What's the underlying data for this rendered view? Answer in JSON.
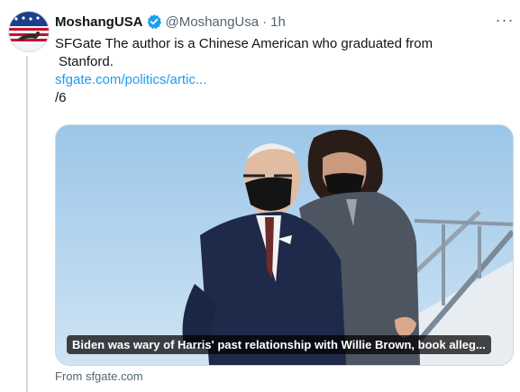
{
  "tweet": {
    "display_name": "MoshangUSA",
    "handle": "@MoshangUsa",
    "separator": "·",
    "time": "1h",
    "more": "···",
    "text_line1": "SFGate The author is a Chinese American who graduated from",
    "text_line2": "Stanford.",
    "link": "sfgate.com/politics/artic...",
    "counter": "/6"
  },
  "card": {
    "caption": "Biden was wary of Harris' past relationship with Willie Brown, book alleg...",
    "source": "From sfgate.com"
  },
  "colors": {
    "link": "#1d9bf0",
    "verified": "#1d9bf0",
    "secondary_text": "#536471"
  },
  "icons": {
    "verified": "verified-badge-icon",
    "more": "more-options-icon"
  }
}
